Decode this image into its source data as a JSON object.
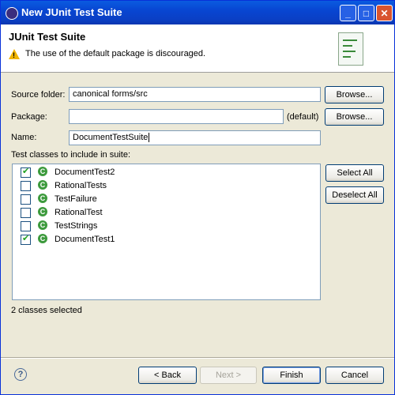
{
  "window": {
    "title": "New JUnit Test Suite",
    "controls": {
      "minimize": "_",
      "maximize": "□",
      "close": "✕"
    }
  },
  "header": {
    "title": "JUnit Test Suite",
    "message": "The use of the default package is discouraged.",
    "message_icon": "warning-icon",
    "graphic_icon": "test-suite-wizard-icon"
  },
  "form": {
    "source_folder": {
      "label": "Source folder:",
      "value": "canonical forms/src",
      "browse": "Browse..."
    },
    "package": {
      "label": "Package:",
      "value": "",
      "suffix": "(default)",
      "browse": "Browse..."
    },
    "name": {
      "label": "Name:",
      "value": "DocumentTestSuite"
    },
    "classes_label": "Test classes to include in suite:"
  },
  "classes": [
    {
      "name": "DocumentTest2",
      "checked": true
    },
    {
      "name": "RationalTests",
      "checked": false
    },
    {
      "name": "TestFailure",
      "checked": false
    },
    {
      "name": "RationalTest",
      "checked": false
    },
    {
      "name": "TestStrings",
      "checked": false
    },
    {
      "name": "DocumentTest1",
      "checked": true
    }
  ],
  "side_buttons": {
    "select_all": "Select All",
    "deselect_all": "Deselect All"
  },
  "status": "2 classes selected",
  "footer": {
    "help_icon": "help-icon",
    "back": "< Back",
    "next": "Next >",
    "finish": "Finish",
    "cancel": "Cancel"
  }
}
